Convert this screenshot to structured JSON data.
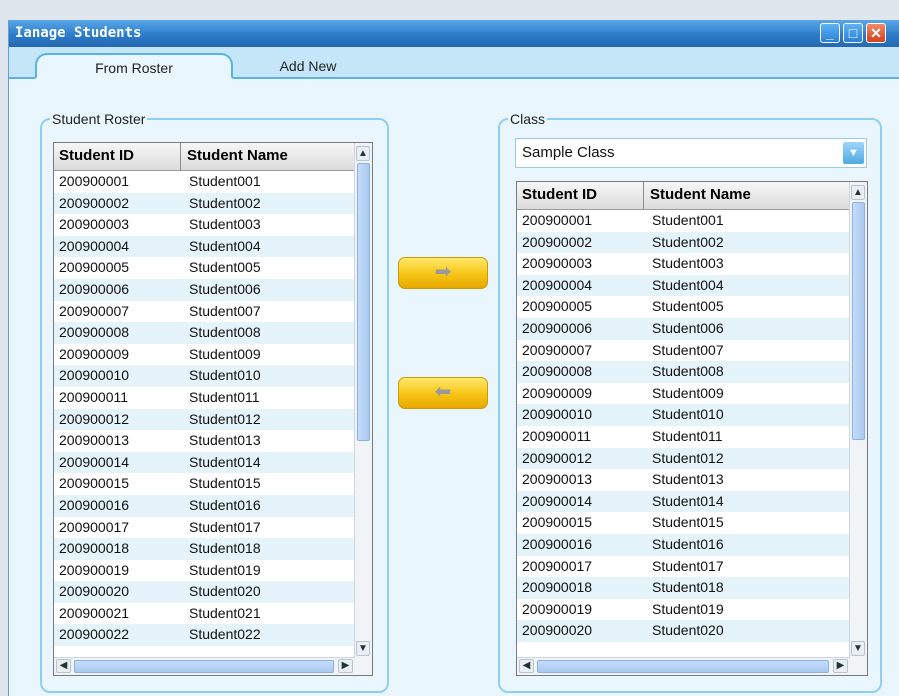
{
  "window": {
    "title": "Manage Students",
    "title_display": "Ianage Students",
    "controls": {
      "minimize": "_",
      "maximize": "□",
      "close": "✕"
    }
  },
  "tabs": [
    {
      "label": "From Roster",
      "active": true
    },
    {
      "label": "Add New",
      "active": false
    }
  ],
  "roster": {
    "group_label": "Student Roster",
    "columns": [
      "Student ID",
      "Student Name"
    ],
    "rows": [
      [
        "200900001",
        "Student001"
      ],
      [
        "200900002",
        "Student002"
      ],
      [
        "200900003",
        "Student003"
      ],
      [
        "200900004",
        "Student004"
      ],
      [
        "200900005",
        "Student005"
      ],
      [
        "200900006",
        "Student006"
      ],
      [
        "200900007",
        "Student007"
      ],
      [
        "200900008",
        "Student008"
      ],
      [
        "200900009",
        "Student009"
      ],
      [
        "200900010",
        "Student010"
      ],
      [
        "200900011",
        "Student011"
      ],
      [
        "200900012",
        "Student012"
      ],
      [
        "200900013",
        "Student013"
      ],
      [
        "200900014",
        "Student014"
      ],
      [
        "200900015",
        "Student015"
      ],
      [
        "200900016",
        "Student016"
      ],
      [
        "200900017",
        "Student017"
      ],
      [
        "200900018",
        "Student018"
      ],
      [
        "200900019",
        "Student019"
      ],
      [
        "200900020",
        "Student020"
      ],
      [
        "200900021",
        "Student021"
      ],
      [
        "200900022",
        "Student022"
      ]
    ]
  },
  "buttons": {
    "add_to_class": "➡",
    "remove_from_class": "⬅"
  },
  "class_panel": {
    "group_label": "Class",
    "selected_class": "Sample Class",
    "dropdown_icon": "▼",
    "columns": [
      "Student ID",
      "Student Name"
    ],
    "rows": [
      [
        "200900001",
        "Student001"
      ],
      [
        "200900002",
        "Student002"
      ],
      [
        "200900003",
        "Student003"
      ],
      [
        "200900004",
        "Student004"
      ],
      [
        "200900005",
        "Student005"
      ],
      [
        "200900006",
        "Student006"
      ],
      [
        "200900007",
        "Student007"
      ],
      [
        "200900008",
        "Student008"
      ],
      [
        "200900009",
        "Student009"
      ],
      [
        "200900010",
        "Student010"
      ],
      [
        "200900011",
        "Student011"
      ],
      [
        "200900012",
        "Student012"
      ],
      [
        "200900013",
        "Student013"
      ],
      [
        "200900014",
        "Student014"
      ],
      [
        "200900015",
        "Student015"
      ],
      [
        "200900016",
        "Student016"
      ],
      [
        "200900017",
        "Student017"
      ],
      [
        "200900018",
        "Student018"
      ],
      [
        "200900019",
        "Student019"
      ],
      [
        "200900020",
        "Student020"
      ]
    ]
  },
  "scroll_glyphs": {
    "up": "▲",
    "down": "▼",
    "left": "◀",
    "right": "▶"
  },
  "colors": {
    "titlebar": "#2c7cc9",
    "tab_strip": "#c5e6f8",
    "accent_border": "#8fd0ef",
    "row_alt": "#e4f4fa",
    "move_button": "#f6c416"
  }
}
